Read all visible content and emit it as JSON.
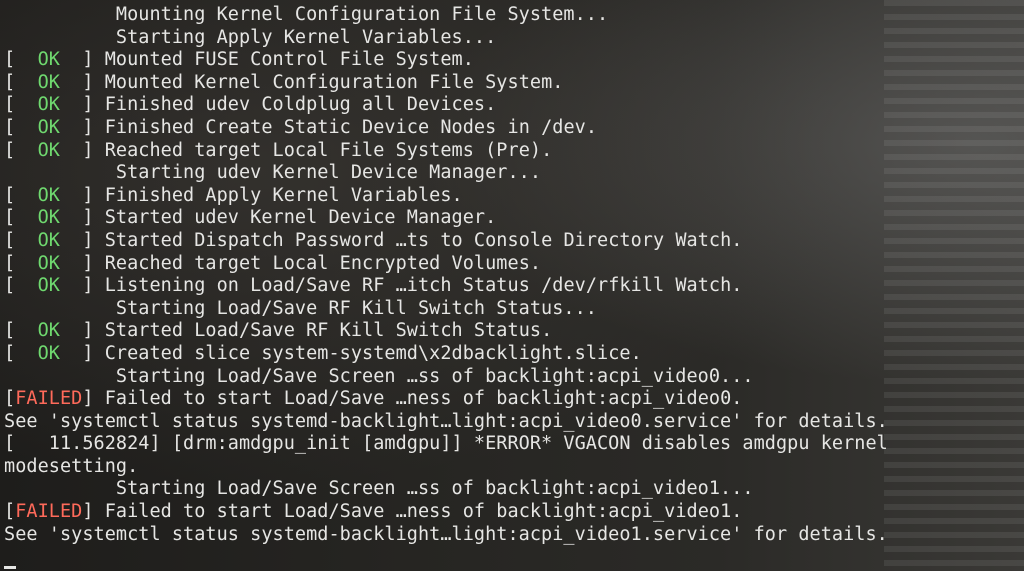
{
  "console": {
    "lines": [
      {
        "prefix": "          ",
        "status": "",
        "status_type": "none",
        "suffix": "",
        "text": "Mounting Kernel Configuration File System..."
      },
      {
        "prefix": "          ",
        "status": "",
        "status_type": "none",
        "suffix": "",
        "text": "Starting Apply Kernel Variables..."
      },
      {
        "prefix": "[  ",
        "status": "OK",
        "status_type": "ok",
        "suffix": "  ] ",
        "text": "Mounted FUSE Control File System."
      },
      {
        "prefix": "[  ",
        "status": "OK",
        "status_type": "ok",
        "suffix": "  ] ",
        "text": "Mounted Kernel Configuration File System."
      },
      {
        "prefix": "[  ",
        "status": "OK",
        "status_type": "ok",
        "suffix": "  ] ",
        "text": "Finished udev Coldplug all Devices."
      },
      {
        "prefix": "[  ",
        "status": "OK",
        "status_type": "ok",
        "suffix": "  ] ",
        "text": "Finished Create Static Device Nodes in /dev."
      },
      {
        "prefix": "[  ",
        "status": "OK",
        "status_type": "ok",
        "suffix": "  ] ",
        "text": "Reached target Local File Systems (Pre)."
      },
      {
        "prefix": "          ",
        "status": "",
        "status_type": "none",
        "suffix": "",
        "text": "Starting udev Kernel Device Manager..."
      },
      {
        "prefix": "[  ",
        "status": "OK",
        "status_type": "ok",
        "suffix": "  ] ",
        "text": "Finished Apply Kernel Variables."
      },
      {
        "prefix": "[  ",
        "status": "OK",
        "status_type": "ok",
        "suffix": "  ] ",
        "text": "Started udev Kernel Device Manager."
      },
      {
        "prefix": "[  ",
        "status": "OK",
        "status_type": "ok",
        "suffix": "  ] ",
        "text": "Started Dispatch Password …ts to Console Directory Watch."
      },
      {
        "prefix": "[  ",
        "status": "OK",
        "status_type": "ok",
        "suffix": "  ] ",
        "text": "Reached target Local Encrypted Volumes."
      },
      {
        "prefix": "[  ",
        "status": "OK",
        "status_type": "ok",
        "suffix": "  ] ",
        "text": "Listening on Load/Save RF …itch Status /dev/rfkill Watch."
      },
      {
        "prefix": "          ",
        "status": "",
        "status_type": "none",
        "suffix": "",
        "text": "Starting Load/Save RF Kill Switch Status..."
      },
      {
        "prefix": "[  ",
        "status": "OK",
        "status_type": "ok",
        "suffix": "  ] ",
        "text": "Started Load/Save RF Kill Switch Status."
      },
      {
        "prefix": "[  ",
        "status": "OK",
        "status_type": "ok",
        "suffix": "  ] ",
        "text": "Created slice system-systemd\\x2dbacklight.slice."
      },
      {
        "prefix": "          ",
        "status": "",
        "status_type": "none",
        "suffix": "",
        "text": "Starting Load/Save Screen …ss of backlight:acpi_video0..."
      },
      {
        "prefix": "[",
        "status": "FAILED",
        "status_type": "failed",
        "suffix": "] ",
        "text": "Failed to start Load/Save …ness of backlight:acpi_video0."
      },
      {
        "prefix": "",
        "status": "",
        "status_type": "none",
        "suffix": "",
        "text": "See 'systemctl status systemd-backlight…light:acpi_video0.service' for details."
      },
      {
        "prefix": "",
        "status": "",
        "status_type": "none",
        "suffix": "",
        "text": "[   11.562824] [drm:amdgpu_init [amdgpu]] *ERROR* VGACON disables amdgpu kernel"
      },
      {
        "prefix": "",
        "status": "",
        "status_type": "none",
        "suffix": "",
        "text": "modesetting."
      },
      {
        "prefix": "          ",
        "status": "",
        "status_type": "none",
        "suffix": "",
        "text": "Starting Load/Save Screen …ss of backlight:acpi_video1..."
      },
      {
        "prefix": "[",
        "status": "FAILED",
        "status_type": "failed",
        "suffix": "] ",
        "text": "Failed to start Load/Save …ness of backlight:acpi_video1."
      },
      {
        "prefix": "",
        "status": "",
        "status_type": "none",
        "suffix": "",
        "text": "See 'systemctl status systemd-backlight…light:acpi_video1.service' for details."
      }
    ],
    "colors": {
      "ok": "#6fd96f",
      "failed": "#ff6a5a",
      "text": "#e6e6e4"
    }
  }
}
